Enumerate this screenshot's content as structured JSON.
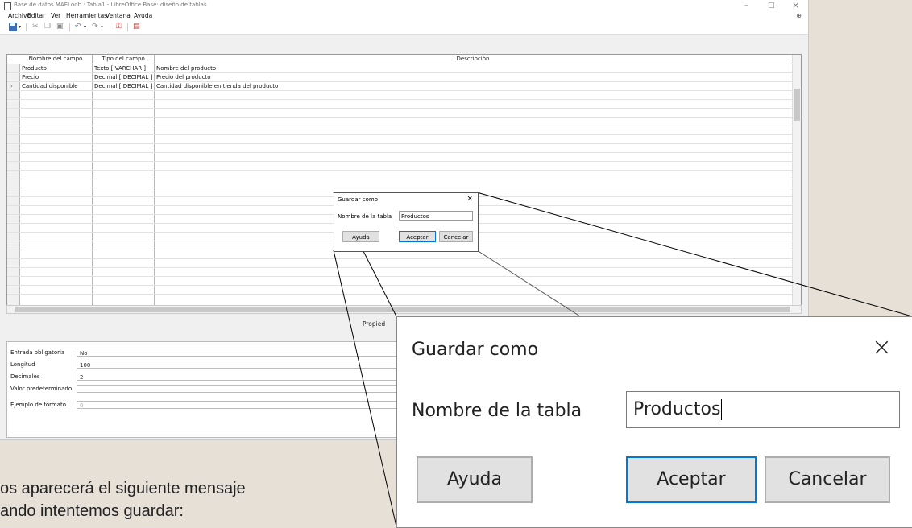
{
  "window": {
    "title": "Base de datos MAELodb : Tabla1 - LibreOffice Base: diseño de tablas",
    "minimize": "–",
    "restore": "□",
    "close": "×"
  },
  "menu": [
    "Archivo",
    "Editar",
    "Ver",
    "Herramientas",
    "Ventana",
    "Ayuda"
  ],
  "grid": {
    "headers": [
      "Nombre del campo",
      "Tipo del campo",
      "Descripción"
    ],
    "rows": [
      {
        "name": "Producto",
        "type": "Texto [ VARCHAR ]",
        "desc": "Nombre del producto"
      },
      {
        "name": "Precio",
        "type": "Decimal [ DECIMAL ]",
        "desc": "Precio del producto"
      },
      {
        "name": "Cantidad disponible",
        "type": "Decimal [ DECIMAL ]",
        "desc": "Cantidad disponible en tienda del producto"
      }
    ],
    "current_row_marker": "›"
  },
  "properties": {
    "title": "Propied",
    "rows": [
      {
        "label": "Entrada obligatoria",
        "value": "No"
      },
      {
        "label": "Longitud",
        "value": "100"
      },
      {
        "label": "Decimales",
        "value": "2"
      },
      {
        "label": "Valor predeterminado",
        "value": ""
      },
      {
        "label": "Ejemplo de formato",
        "value": "0"
      }
    ]
  },
  "dialog": {
    "title": "Guardar como",
    "close": "×",
    "label": "Nombre de la tabla",
    "value": "Productos",
    "help": "Ayuda",
    "ok": "Aceptar",
    "cancel": "Cancelar"
  },
  "caption": {
    "line1": "os aparecerá el siguiente mensaje",
    "line2": "ando intentemos guardar:"
  },
  "colors": {
    "default_button_border": "#0078d7",
    "save_icon": "#3d6fb5"
  }
}
